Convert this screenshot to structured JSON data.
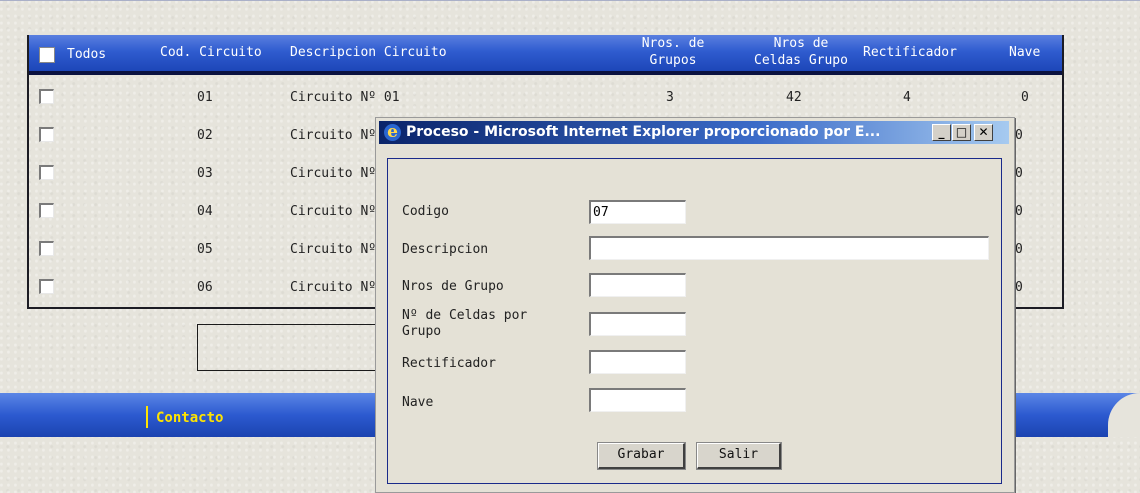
{
  "grid": {
    "headers": {
      "todos": "Todos",
      "cod": "Cod. Circuito",
      "desc": "Descripcion Circuito",
      "grupos_1": "Nros. de",
      "grupos_2": "Grupos",
      "celdas_1": "Nros de",
      "celdas_2": "Celdas Grupo",
      "rect": "Rectificador",
      "nave": "Nave"
    },
    "rows": [
      {
        "cod": "01",
        "desc": "Circuito Nº 01",
        "grupos": "3",
        "celdas": "42",
        "rect": "4",
        "nave": "0"
      },
      {
        "cod": "02",
        "desc": "Circuito Nº",
        "grupos": "",
        "celdas": "",
        "rect": "",
        "nave": "0"
      },
      {
        "cod": "03",
        "desc": "Circuito Nº",
        "grupos": "",
        "celdas": "",
        "rect": "",
        "nave": "0"
      },
      {
        "cod": "04",
        "desc": "Circuito Nº",
        "grupos": "",
        "celdas": "",
        "rect": "",
        "nave": "0"
      },
      {
        "cod": "05",
        "desc": "Circuito Nº",
        "grupos": "",
        "celdas": "",
        "rect": "",
        "nave": "0"
      },
      {
        "cod": "06",
        "desc": "Circuito Nº",
        "grupos": "",
        "celdas": "",
        "rect": "",
        "nave": "0"
      }
    ]
  },
  "nav": {
    "contacto": "Contacto"
  },
  "popup": {
    "title": "Proceso - Microsoft Internet Explorer proporcionado por E...",
    "fields": {
      "codigo": {
        "label": "Codigo",
        "value": "07"
      },
      "descripcion": {
        "label": "Descripcion",
        "value": ""
      },
      "nros_grupo": {
        "label": "Nros de Grupo",
        "value": ""
      },
      "celdas_1": "Nº de Celdas por",
      "celdas_2": "Grupo",
      "celdas_value": "",
      "rectificador": {
        "label": "Rectificador",
        "value": ""
      },
      "nave": {
        "label": "Nave",
        "value": ""
      }
    },
    "buttons": {
      "grabar": "Grabar",
      "salir": "Salir"
    }
  }
}
